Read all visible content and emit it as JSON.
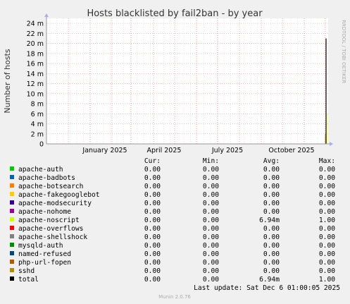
{
  "chart_data": {
    "type": "line",
    "title": "Hosts blacklisted by fail2ban - by year",
    "ylabel": "Number of hosts",
    "xlabel": "",
    "ylim": [
      0,
      25
    ],
    "y_ticks": [
      "0",
      "2",
      "4",
      "6",
      "8",
      "10",
      "12",
      "14",
      "16",
      "18",
      "20",
      "22",
      "24 m"
    ],
    "y_tick_labels": [
      "0",
      "2 m",
      "4 m",
      "6 m",
      "8 m",
      "10 m",
      "12 m",
      "14 m",
      "16 m",
      "18 m",
      "20 m",
      "22 m",
      "24 m"
    ],
    "x_tick_labels": [
      "January 2025",
      "April 2025",
      "July 2025",
      "October 2025"
    ],
    "grid": true,
    "side_text": "RRDTOOL / TOBI OETIKER",
    "columns": [
      "",
      "Cur:",
      "Min:",
      "Avg:",
      "Max:"
    ],
    "series": [
      {
        "name": "apache-auth",
        "color": "#00cc00",
        "cur": "0.00",
        "min": "0.00",
        "avg": "0.00",
        "max": "0.00"
      },
      {
        "name": "apache-badbots",
        "color": "#0066b3",
        "cur": "0.00",
        "min": "0.00",
        "avg": "0.00",
        "max": "0.00"
      },
      {
        "name": "apache-botsearch",
        "color": "#ff8000",
        "cur": "0.00",
        "min": "0.00",
        "avg": "0.00",
        "max": "0.00"
      },
      {
        "name": "apache-fakegooglebot",
        "color": "#ffcc00",
        "cur": "0.00",
        "min": "0.00",
        "avg": "0.00",
        "max": "0.00"
      },
      {
        "name": "apache-modsecurity",
        "color": "#330099",
        "cur": "0.00",
        "min": "0.00",
        "avg": "0.00",
        "max": "0.00"
      },
      {
        "name": "apache-nohome",
        "color": "#990099",
        "cur": "0.00",
        "min": "0.00",
        "avg": "0.00",
        "max": "0.00"
      },
      {
        "name": "apache-noscript",
        "color": "#ccff00",
        "cur": "0.00",
        "min": "0.00",
        "avg": "6.94m",
        "max": "1.00"
      },
      {
        "name": "apache-overflows",
        "color": "#ff0000",
        "cur": "0.00",
        "min": "0.00",
        "avg": "0.00",
        "max": "0.00"
      },
      {
        "name": "apache-shellshock",
        "color": "#808080",
        "cur": "0.00",
        "min": "0.00",
        "avg": "0.00",
        "max": "0.00"
      },
      {
        "name": "mysqld-auth",
        "color": "#008f00",
        "cur": "0.00",
        "min": "0.00",
        "avg": "0.00",
        "max": "0.00"
      },
      {
        "name": "named-refused",
        "color": "#00487d",
        "cur": "0.00",
        "min": "0.00",
        "avg": "0.00",
        "max": "0.00"
      },
      {
        "name": "php-url-fopen",
        "color": "#b35a00",
        "cur": "0.00",
        "min": "0.00",
        "avg": "0.00",
        "max": "0.00"
      },
      {
        "name": "sshd",
        "color": "#b38f00",
        "cur": "0.00",
        "min": "0.00",
        "avg": "0.00",
        "max": "0.00"
      },
      {
        "name": "total",
        "color": "#000000",
        "cur": "0.00",
        "min": "0.00",
        "avg": "6.94m",
        "max": "1.00"
      }
    ],
    "spike": {
      "series": "total",
      "value": 21
    }
  },
  "last_update": "Last update: Sat Dec  6 01:00:05 2025",
  "munin_version": "Munin 2.0.76"
}
